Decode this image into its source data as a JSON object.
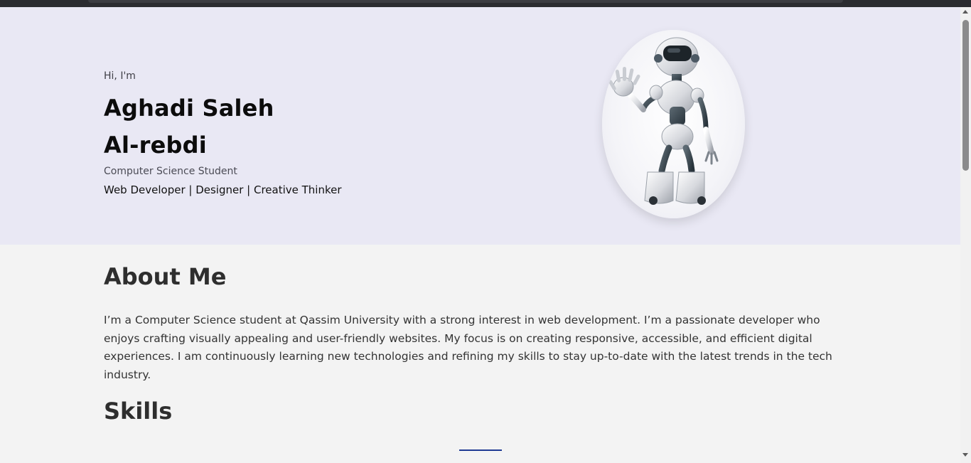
{
  "hero": {
    "greeting": "Hi, I'm",
    "name_line1": "Aghadi Saleh",
    "name_line2": "Al-rebdi",
    "role": "Computer Science Student",
    "tagline": "Web Developer | Designer | Creative Thinker",
    "avatar_icon": "robot-illustration"
  },
  "about": {
    "title": "About Me",
    "text": "I’m a Computer Science student at Qassim University with a strong interest in web development. I’m a passionate developer who enjoys crafting visually appealing and user-friendly websites. My focus is on creating responsive, accessible, and efficient digital experiences. I am continuously learning new technologies and refining my skills to stay up-to-date with the latest trends in the tech industry."
  },
  "skills": {
    "title": "Skills"
  },
  "colors": {
    "hero_background": "#e9e8f4",
    "page_background": "#f3f3f3",
    "accent": "#1f3a93"
  }
}
